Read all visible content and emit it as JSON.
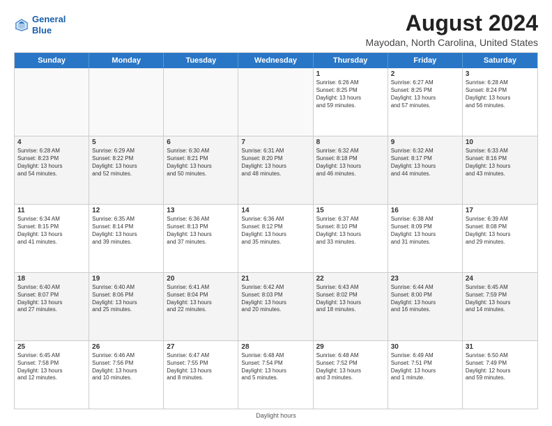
{
  "header": {
    "logo_line1": "General",
    "logo_line2": "Blue",
    "title": "August 2024",
    "subtitle": "Mayodan, North Carolina, United States"
  },
  "days": [
    "Sunday",
    "Monday",
    "Tuesday",
    "Wednesday",
    "Thursday",
    "Friday",
    "Saturday"
  ],
  "weeks": [
    [
      {
        "day": "",
        "empty": true
      },
      {
        "day": "",
        "empty": true
      },
      {
        "day": "",
        "empty": true
      },
      {
        "day": "",
        "empty": true
      },
      {
        "day": "1",
        "rise": "6:26 AM",
        "set": "8:25 PM",
        "hours": "13 hours",
        "mins": "59 minutes"
      },
      {
        "day": "2",
        "rise": "6:27 AM",
        "set": "8:25 PM",
        "hours": "13 hours",
        "mins": "57 minutes"
      },
      {
        "day": "3",
        "rise": "6:28 AM",
        "set": "8:24 PM",
        "hours": "13 hours",
        "mins": "56 minutes"
      }
    ],
    [
      {
        "day": "4",
        "rise": "6:28 AM",
        "set": "8:23 PM",
        "hours": "13 hours",
        "mins": "54 minutes"
      },
      {
        "day": "5",
        "rise": "6:29 AM",
        "set": "8:22 PM",
        "hours": "13 hours",
        "mins": "52 minutes"
      },
      {
        "day": "6",
        "rise": "6:30 AM",
        "set": "8:21 PM",
        "hours": "13 hours",
        "mins": "50 minutes"
      },
      {
        "day": "7",
        "rise": "6:31 AM",
        "set": "8:20 PM",
        "hours": "13 hours",
        "mins": "48 minutes"
      },
      {
        "day": "8",
        "rise": "6:32 AM",
        "set": "8:18 PM",
        "hours": "13 hours",
        "mins": "46 minutes"
      },
      {
        "day": "9",
        "rise": "6:32 AM",
        "set": "8:17 PM",
        "hours": "13 hours",
        "mins": "44 minutes"
      },
      {
        "day": "10",
        "rise": "6:33 AM",
        "set": "8:16 PM",
        "hours": "13 hours",
        "mins": "43 minutes"
      }
    ],
    [
      {
        "day": "11",
        "rise": "6:34 AM",
        "set": "8:15 PM",
        "hours": "13 hours",
        "mins": "41 minutes"
      },
      {
        "day": "12",
        "rise": "6:35 AM",
        "set": "8:14 PM",
        "hours": "13 hours",
        "mins": "39 minutes"
      },
      {
        "day": "13",
        "rise": "6:36 AM",
        "set": "8:13 PM",
        "hours": "13 hours",
        "mins": "37 minutes"
      },
      {
        "day": "14",
        "rise": "6:36 AM",
        "set": "8:12 PM",
        "hours": "13 hours",
        "mins": "35 minutes"
      },
      {
        "day": "15",
        "rise": "6:37 AM",
        "set": "8:10 PM",
        "hours": "13 hours",
        "mins": "33 minutes"
      },
      {
        "day": "16",
        "rise": "6:38 AM",
        "set": "8:09 PM",
        "hours": "13 hours",
        "mins": "31 minutes"
      },
      {
        "day": "17",
        "rise": "6:39 AM",
        "set": "8:08 PM",
        "hours": "13 hours",
        "mins": "29 minutes"
      }
    ],
    [
      {
        "day": "18",
        "rise": "6:40 AM",
        "set": "8:07 PM",
        "hours": "13 hours",
        "mins": "27 minutes"
      },
      {
        "day": "19",
        "rise": "6:40 AM",
        "set": "8:06 PM",
        "hours": "13 hours",
        "mins": "25 minutes"
      },
      {
        "day": "20",
        "rise": "6:41 AM",
        "set": "8:04 PM",
        "hours": "13 hours",
        "mins": "22 minutes"
      },
      {
        "day": "21",
        "rise": "6:42 AM",
        "set": "8:03 PM",
        "hours": "13 hours",
        "mins": "20 minutes"
      },
      {
        "day": "22",
        "rise": "6:43 AM",
        "set": "8:02 PM",
        "hours": "13 hours",
        "mins": "18 minutes"
      },
      {
        "day": "23",
        "rise": "6:44 AM",
        "set": "8:00 PM",
        "hours": "13 hours",
        "mins": "16 minutes"
      },
      {
        "day": "24",
        "rise": "6:45 AM",
        "set": "7:59 PM",
        "hours": "13 hours",
        "mins": "14 minutes"
      }
    ],
    [
      {
        "day": "25",
        "rise": "6:45 AM",
        "set": "7:58 PM",
        "hours": "13 hours",
        "mins": "12 minutes"
      },
      {
        "day": "26",
        "rise": "6:46 AM",
        "set": "7:56 PM",
        "hours": "13 hours",
        "mins": "10 minutes"
      },
      {
        "day": "27",
        "rise": "6:47 AM",
        "set": "7:55 PM",
        "hours": "13 hours",
        "mins": "8 minutes"
      },
      {
        "day": "28",
        "rise": "6:48 AM",
        "set": "7:54 PM",
        "hours": "13 hours",
        "mins": "5 minutes"
      },
      {
        "day": "29",
        "rise": "6:48 AM",
        "set": "7:52 PM",
        "hours": "13 hours",
        "mins": "3 minutes"
      },
      {
        "day": "30",
        "rise": "6:49 AM",
        "set": "7:51 PM",
        "hours": "13 hours",
        "mins": "1 minute"
      },
      {
        "day": "31",
        "rise": "6:50 AM",
        "set": "7:49 PM",
        "hours": "12 hours",
        "mins": "59 minutes"
      }
    ]
  ],
  "footer": "Daylight hours"
}
